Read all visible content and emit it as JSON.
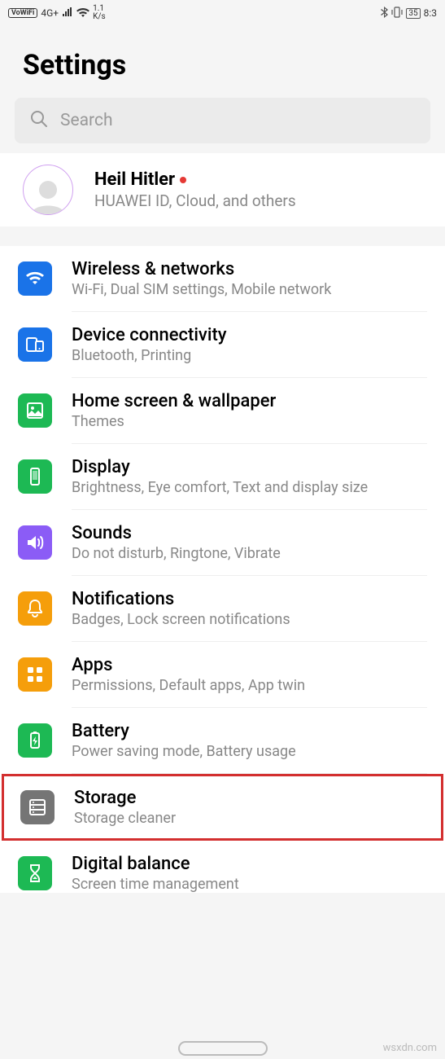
{
  "status": {
    "volte": "VoWiFi",
    "net": "4G+",
    "speed_val": "1.1",
    "speed_unit": "K/s",
    "battery": "35",
    "time": "8:3"
  },
  "header": {
    "title": "Settings"
  },
  "search": {
    "placeholder": "Search"
  },
  "account": {
    "name": "Heil Hitler",
    "subtitle": "HUAWEI ID, Cloud, and others"
  },
  "items": [
    {
      "title": "Wireless & networks",
      "subtitle": "Wi-Fi, Dual SIM settings, Mobile network",
      "color": "#1a73e8",
      "icon": "wifi"
    },
    {
      "title": "Device connectivity",
      "subtitle": "Bluetooth, Printing",
      "color": "#1a73e8",
      "icon": "devices"
    },
    {
      "title": "Home screen & wallpaper",
      "subtitle": "Themes",
      "color": "#1db954",
      "icon": "image"
    },
    {
      "title": "Display",
      "subtitle": "Brightness, Eye comfort, Text and display size",
      "color": "#1db954",
      "icon": "phone"
    },
    {
      "title": "Sounds",
      "subtitle": "Do not disturb, Ringtone, Vibrate",
      "color": "#8b5cf6",
      "icon": "sound"
    },
    {
      "title": "Notifications",
      "subtitle": "Badges, Lock screen notifications",
      "color": "#f59e0b",
      "icon": "bell"
    },
    {
      "title": "Apps",
      "subtitle": "Permissions, Default apps, App twin",
      "color": "#f59e0b",
      "icon": "apps"
    },
    {
      "title": "Battery",
      "subtitle": "Power saving mode, Battery usage",
      "color": "#1db954",
      "icon": "battery"
    },
    {
      "title": "Storage",
      "subtitle": "Storage cleaner",
      "color": "#757575",
      "icon": "storage",
      "highlighted": true
    },
    {
      "title": "Digital balance",
      "subtitle": "Screen time management",
      "color": "#1db954",
      "icon": "hourglass"
    }
  ],
  "watermark": "wsxdn.com"
}
